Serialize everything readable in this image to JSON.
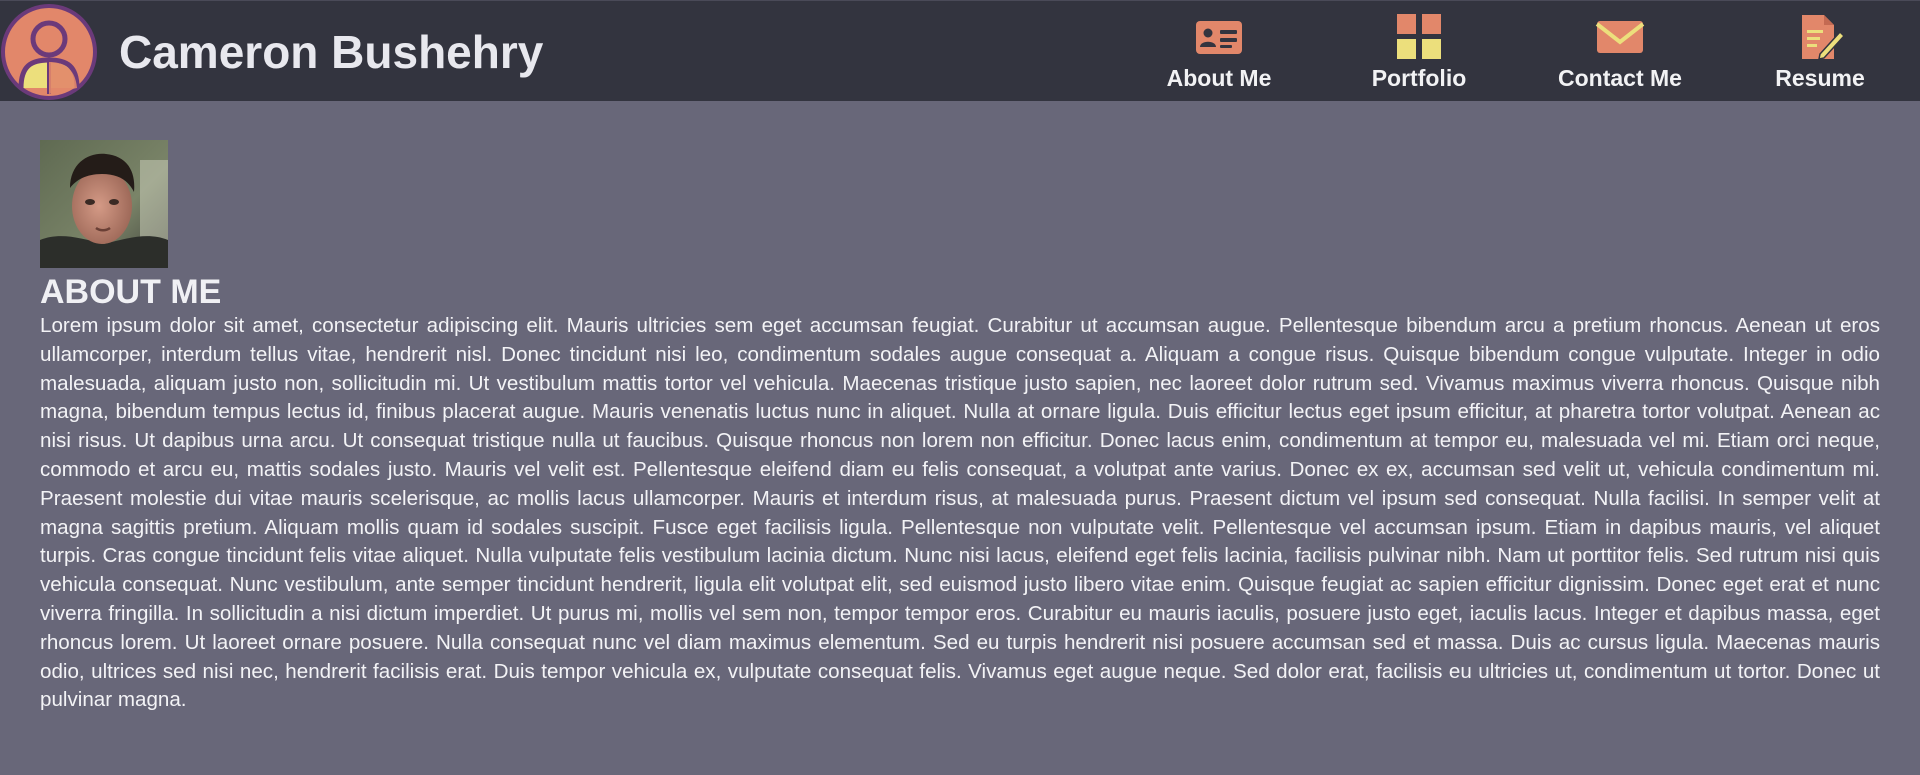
{
  "header": {
    "site_name": "Cameron Bushehry",
    "logo_icon": "user-avatar-icon"
  },
  "nav": {
    "items": [
      {
        "label": "About Me",
        "icon": "id-card-icon"
      },
      {
        "label": "Portfolio",
        "icon": "grid-icon"
      },
      {
        "label": "Contact Me",
        "icon": "envelope-icon"
      },
      {
        "label": "Resume",
        "icon": "document-pen-icon"
      }
    ]
  },
  "about": {
    "photo_alt": "Profile photo",
    "heading": "ABOUT ME",
    "text": "Lorem ipsum dolor sit amet, consectetur adipiscing elit. Mauris ultricies sem eget accumsan feugiat. Curabitur ut accumsan augue. Pellentesque bibendum arcu a pretium rhoncus. Aenean ut eros ullamcorper, interdum tellus vitae, hendrerit nisl. Donec tincidunt nisi leo, condimentum sodales augue consequat a. Aliquam a congue risus. Quisque bibendum congue vulputate. Integer in odio malesuada, aliquam justo non, sollicitudin mi. Ut vestibulum mattis tortor vel vehicula. Maecenas tristique justo sapien, nec laoreet dolor rutrum sed. Vivamus maximus viverra rhoncus. Quisque nibh magna, bibendum tempus lectus id, finibus placerat augue. Mauris venenatis luctus nunc in aliquet. Nulla at ornare ligula. Duis efficitur lectus eget ipsum efficitur, at pharetra tortor volutpat. Aenean ac nisi risus. Ut dapibus urna arcu. Ut consequat tristique nulla ut faucibus. Quisque rhoncus non lorem non efficitur. Donec lacus enim, condimentum at tempor eu, malesuada vel mi. Etiam orci neque, commodo et arcu eu, mattis sodales justo. Mauris vel velit est. Pellentesque eleifend diam eu felis consequat, a volutpat ante varius. Donec ex ex, accumsan sed velit ut, vehicula condimentum mi. Praesent molestie dui vitae mauris scelerisque, ac mollis lacus ullamcorper. Mauris et interdum risus, at malesuada purus. Praesent dictum vel ipsum sed consequat. Nulla facilisi. In semper velit at magna sagittis pretium. Aliquam mollis quam id sodales suscipit. Fusce eget facilisis ligula. Pellentesque non vulputate velit. Pellentesque vel accumsan ipsum. Etiam in dapibus mauris, vel aliquet turpis. Cras congue tincidunt felis vitae aliquet. Nulla vulputate felis vestibulum lacinia dictum. Nunc nisi lacus, eleifend eget felis lacinia, facilisis pulvinar nibh. Nam ut porttitor felis. Sed rutrum nisi quis vehicula consequat. Nunc vestibulum, ante semper tincidunt hendrerit, ligula elit volutpat elit, sed euismod justo libero vitae enim. Quisque feugiat ac sapien efficitur dignissim. Donec eget erat et nunc viverra fringilla. In sollicitudin a nisi dictum imperdiet. Ut purus mi, mollis vel sem non, tempor tempor eros. Curabitur eu mauris iaculis, posuere justo eget, iaculis lacus. Integer et dapibus massa, eget rhoncus lorem. Ut laoreet ornare posuere. Nulla consequat nunc vel diam maximus elementum. Sed eu turpis hendrerit nisi posuere accumsan sed et massa. Duis ac cursus ligula. Maecenas mauris odio, ultrices sed nisi nec, hendrerit facilisis erat. Duis tempor vehicula ex, vulputate consequat felis. Vivamus eget augue neque. Sed dolor erat, facilisis eu ultricies ut, condimentum ut tortor. Donec ut pulvinar magna."
  },
  "colors": {
    "header_bg": "#33343f",
    "page_bg": "#686779",
    "accent_orange": "#e2876a",
    "accent_yellow": "#ecdf7c",
    "accent_purple": "#6b3a7a"
  }
}
